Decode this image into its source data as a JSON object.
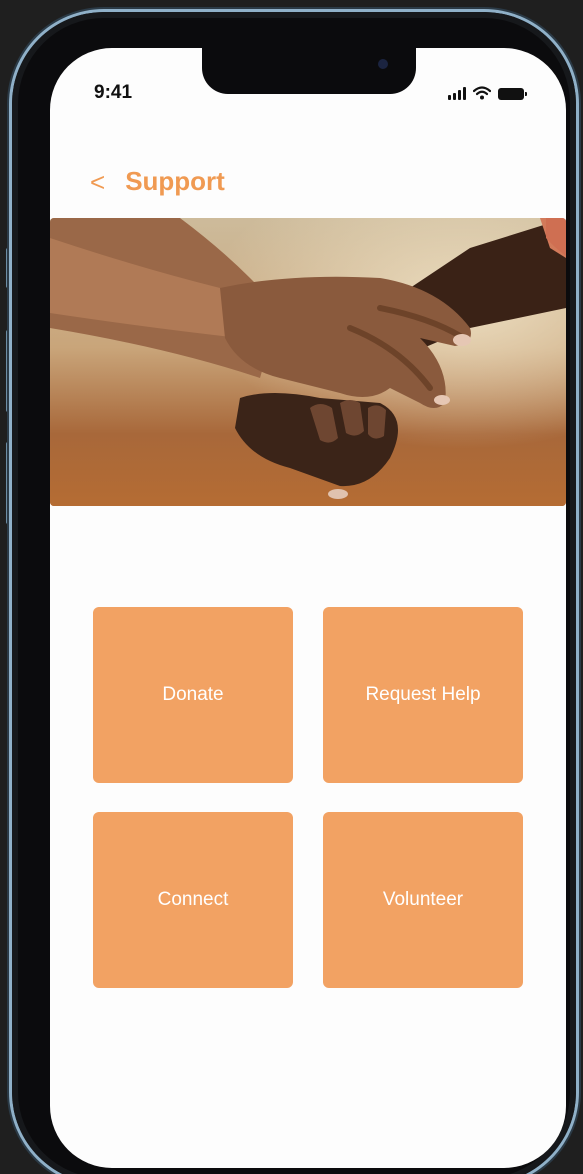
{
  "status_bar": {
    "time": "9:41",
    "icons": [
      "cellular-signal-icon",
      "wifi-icon",
      "battery-icon"
    ]
  },
  "header": {
    "back_icon": "chevron-left-icon",
    "back_glyph": "<",
    "title": "Support"
  },
  "hero": {
    "image": "clasped-hands-photo"
  },
  "actions": [
    {
      "label": "Donate"
    },
    {
      "label": "Request Help"
    },
    {
      "label": "Connect"
    },
    {
      "label": "Volunteer"
    }
  ],
  "colors": {
    "accent": "#f09a52",
    "tile": "#f2a263",
    "background": "#fdfdfd",
    "frame": "#0b0b0d"
  }
}
